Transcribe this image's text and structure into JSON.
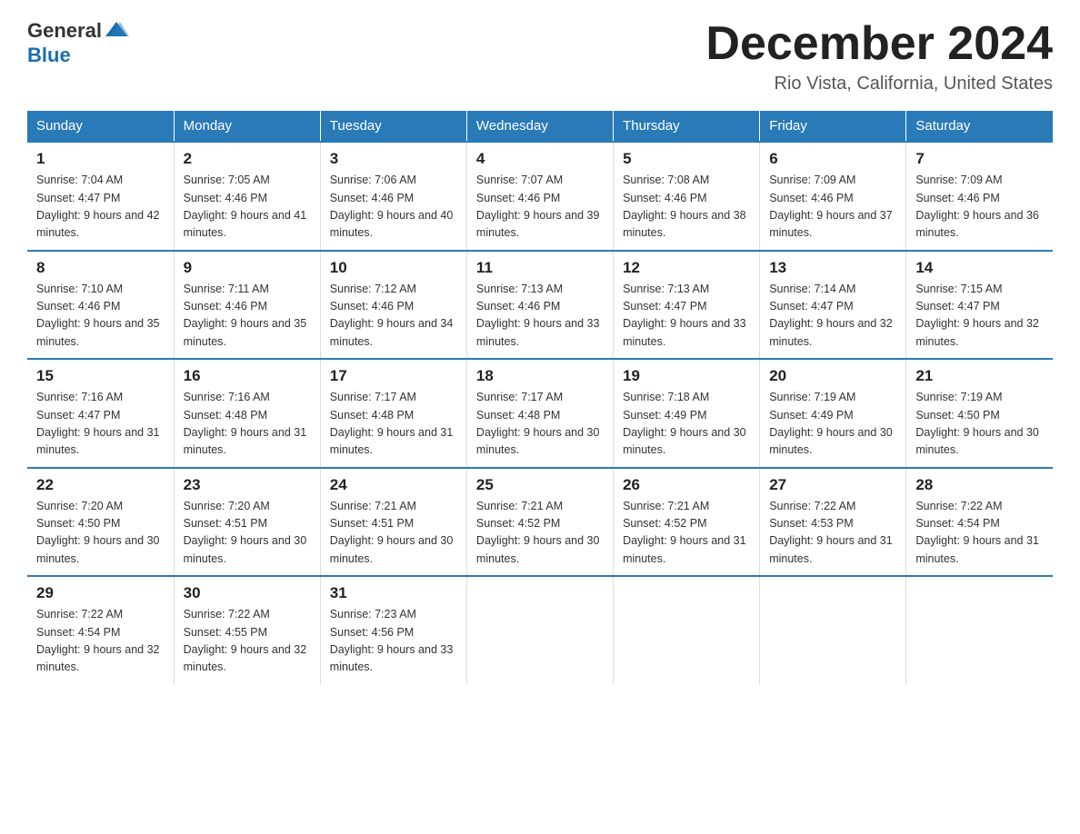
{
  "header": {
    "logo_general": "General",
    "logo_blue": "Blue",
    "month": "December 2024",
    "location": "Rio Vista, California, United States"
  },
  "days_of_week": [
    "Sunday",
    "Monday",
    "Tuesday",
    "Wednesday",
    "Thursday",
    "Friday",
    "Saturday"
  ],
  "weeks": [
    [
      {
        "day": "1",
        "sunrise": "Sunrise: 7:04 AM",
        "sunset": "Sunset: 4:47 PM",
        "daylight": "Daylight: 9 hours and 42 minutes."
      },
      {
        "day": "2",
        "sunrise": "Sunrise: 7:05 AM",
        "sunset": "Sunset: 4:46 PM",
        "daylight": "Daylight: 9 hours and 41 minutes."
      },
      {
        "day": "3",
        "sunrise": "Sunrise: 7:06 AM",
        "sunset": "Sunset: 4:46 PM",
        "daylight": "Daylight: 9 hours and 40 minutes."
      },
      {
        "day": "4",
        "sunrise": "Sunrise: 7:07 AM",
        "sunset": "Sunset: 4:46 PM",
        "daylight": "Daylight: 9 hours and 39 minutes."
      },
      {
        "day": "5",
        "sunrise": "Sunrise: 7:08 AM",
        "sunset": "Sunset: 4:46 PM",
        "daylight": "Daylight: 9 hours and 38 minutes."
      },
      {
        "day": "6",
        "sunrise": "Sunrise: 7:09 AM",
        "sunset": "Sunset: 4:46 PM",
        "daylight": "Daylight: 9 hours and 37 minutes."
      },
      {
        "day": "7",
        "sunrise": "Sunrise: 7:09 AM",
        "sunset": "Sunset: 4:46 PM",
        "daylight": "Daylight: 9 hours and 36 minutes."
      }
    ],
    [
      {
        "day": "8",
        "sunrise": "Sunrise: 7:10 AM",
        "sunset": "Sunset: 4:46 PM",
        "daylight": "Daylight: 9 hours and 35 minutes."
      },
      {
        "day": "9",
        "sunrise": "Sunrise: 7:11 AM",
        "sunset": "Sunset: 4:46 PM",
        "daylight": "Daylight: 9 hours and 35 minutes."
      },
      {
        "day": "10",
        "sunrise": "Sunrise: 7:12 AM",
        "sunset": "Sunset: 4:46 PM",
        "daylight": "Daylight: 9 hours and 34 minutes."
      },
      {
        "day": "11",
        "sunrise": "Sunrise: 7:13 AM",
        "sunset": "Sunset: 4:46 PM",
        "daylight": "Daylight: 9 hours and 33 minutes."
      },
      {
        "day": "12",
        "sunrise": "Sunrise: 7:13 AM",
        "sunset": "Sunset: 4:47 PM",
        "daylight": "Daylight: 9 hours and 33 minutes."
      },
      {
        "day": "13",
        "sunrise": "Sunrise: 7:14 AM",
        "sunset": "Sunset: 4:47 PM",
        "daylight": "Daylight: 9 hours and 32 minutes."
      },
      {
        "day": "14",
        "sunrise": "Sunrise: 7:15 AM",
        "sunset": "Sunset: 4:47 PM",
        "daylight": "Daylight: 9 hours and 32 minutes."
      }
    ],
    [
      {
        "day": "15",
        "sunrise": "Sunrise: 7:16 AM",
        "sunset": "Sunset: 4:47 PM",
        "daylight": "Daylight: 9 hours and 31 minutes."
      },
      {
        "day": "16",
        "sunrise": "Sunrise: 7:16 AM",
        "sunset": "Sunset: 4:48 PM",
        "daylight": "Daylight: 9 hours and 31 minutes."
      },
      {
        "day": "17",
        "sunrise": "Sunrise: 7:17 AM",
        "sunset": "Sunset: 4:48 PM",
        "daylight": "Daylight: 9 hours and 31 minutes."
      },
      {
        "day": "18",
        "sunrise": "Sunrise: 7:17 AM",
        "sunset": "Sunset: 4:48 PM",
        "daylight": "Daylight: 9 hours and 30 minutes."
      },
      {
        "day": "19",
        "sunrise": "Sunrise: 7:18 AM",
        "sunset": "Sunset: 4:49 PM",
        "daylight": "Daylight: 9 hours and 30 minutes."
      },
      {
        "day": "20",
        "sunrise": "Sunrise: 7:19 AM",
        "sunset": "Sunset: 4:49 PM",
        "daylight": "Daylight: 9 hours and 30 minutes."
      },
      {
        "day": "21",
        "sunrise": "Sunrise: 7:19 AM",
        "sunset": "Sunset: 4:50 PM",
        "daylight": "Daylight: 9 hours and 30 minutes."
      }
    ],
    [
      {
        "day": "22",
        "sunrise": "Sunrise: 7:20 AM",
        "sunset": "Sunset: 4:50 PM",
        "daylight": "Daylight: 9 hours and 30 minutes."
      },
      {
        "day": "23",
        "sunrise": "Sunrise: 7:20 AM",
        "sunset": "Sunset: 4:51 PM",
        "daylight": "Daylight: 9 hours and 30 minutes."
      },
      {
        "day": "24",
        "sunrise": "Sunrise: 7:21 AM",
        "sunset": "Sunset: 4:51 PM",
        "daylight": "Daylight: 9 hours and 30 minutes."
      },
      {
        "day": "25",
        "sunrise": "Sunrise: 7:21 AM",
        "sunset": "Sunset: 4:52 PM",
        "daylight": "Daylight: 9 hours and 30 minutes."
      },
      {
        "day": "26",
        "sunrise": "Sunrise: 7:21 AM",
        "sunset": "Sunset: 4:52 PM",
        "daylight": "Daylight: 9 hours and 31 minutes."
      },
      {
        "day": "27",
        "sunrise": "Sunrise: 7:22 AM",
        "sunset": "Sunset: 4:53 PM",
        "daylight": "Daylight: 9 hours and 31 minutes."
      },
      {
        "day": "28",
        "sunrise": "Sunrise: 7:22 AM",
        "sunset": "Sunset: 4:54 PM",
        "daylight": "Daylight: 9 hours and 31 minutes."
      }
    ],
    [
      {
        "day": "29",
        "sunrise": "Sunrise: 7:22 AM",
        "sunset": "Sunset: 4:54 PM",
        "daylight": "Daylight: 9 hours and 32 minutes."
      },
      {
        "day": "30",
        "sunrise": "Sunrise: 7:22 AM",
        "sunset": "Sunset: 4:55 PM",
        "daylight": "Daylight: 9 hours and 32 minutes."
      },
      {
        "day": "31",
        "sunrise": "Sunrise: 7:23 AM",
        "sunset": "Sunset: 4:56 PM",
        "daylight": "Daylight: 9 hours and 33 minutes."
      },
      null,
      null,
      null,
      null
    ]
  ]
}
